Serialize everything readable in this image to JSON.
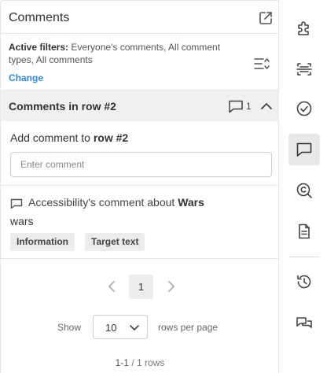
{
  "header": {
    "title": "Comments",
    "open_icon": "open-external-icon"
  },
  "filters": {
    "label": "Active filters:",
    "value": "Everyone's comments, All comment types, All comments",
    "change_label": "Change",
    "sort_icon": "sort-filter-icon"
  },
  "row": {
    "title": "Comments in row #2",
    "comment_count": "1",
    "count_icon": "comment-icon",
    "collapse_icon": "chevron-up-icon"
  },
  "add_comment": {
    "label_prefix": "Add comment to",
    "label_target": "row #2",
    "placeholder": "Enter comment"
  },
  "comments": [
    {
      "author_prefix": "Accessibility's comment about",
      "subject": "Wars",
      "body": "wars",
      "tags": [
        "Information",
        "Target text"
      ]
    }
  ],
  "pagination": {
    "current_page": "1",
    "show_label": "Show",
    "rows_per_page": "10",
    "rows_per_page_label": "rows per page",
    "range": "1-1",
    "total": "/ 1 rows"
  },
  "toolbar": {
    "items": [
      {
        "icon": "puzzle-icon",
        "active": false
      },
      {
        "icon": "scan-text-icon",
        "active": false
      },
      {
        "icon": "check-circle-icon",
        "active": false
      },
      {
        "icon": "comment-icon",
        "active": true
      },
      {
        "icon": "search-copyright-icon",
        "active": false
      },
      {
        "icon": "document-icon",
        "active": false
      },
      {
        "icon": "history-icon",
        "active": false
      },
      {
        "icon": "conversation-icon",
        "active": false
      }
    ]
  },
  "colors": {
    "link": "#2f8ae0",
    "section_bg": "#f0f0f0",
    "active_tool_bg": "#e8e8e8"
  }
}
